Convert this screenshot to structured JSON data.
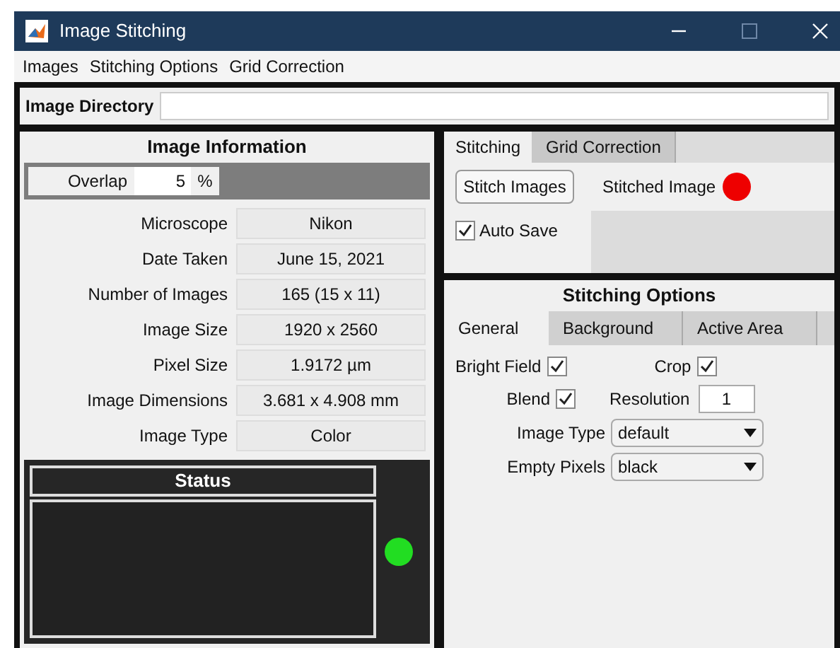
{
  "window": {
    "title": "Image Stitching"
  },
  "menu": [
    "Images",
    "Stitching Options",
    "Grid Correction"
  ],
  "directory": {
    "label": "Image Directory"
  },
  "info": {
    "title": "Image Information",
    "overlap_label": "Overlap",
    "overlap_value": "5",
    "overlap_unit": "%",
    "rows": [
      {
        "label": "Microscope",
        "value": "Nikon"
      },
      {
        "label": "Date Taken",
        "value": "June 15, 2021"
      },
      {
        "label": "Number of Images",
        "value": "165 (15 x 11)"
      },
      {
        "label": "Image Size",
        "value": "1920 x 2560"
      },
      {
        "label": "Pixel Size",
        "value": "1.9172 µm"
      },
      {
        "label": "Image Dimensions",
        "value": "3.681 x 4.908 mm"
      },
      {
        "label": "Image Type",
        "value": "Color"
      }
    ],
    "status": {
      "title": "Status",
      "color": "#22dd22"
    }
  },
  "tabs": [
    {
      "label": "Stitching",
      "selected": true
    },
    {
      "label": "Grid Correction",
      "selected": false
    }
  ],
  "stitch": {
    "button": "Stitch Images",
    "auto_save": {
      "label": "Auto Save",
      "checked": true
    },
    "stitched": {
      "label": "Stitched Image",
      "color": "#ee0000"
    }
  },
  "options": {
    "title": "Stitching Options",
    "tabs": [
      {
        "label": "General",
        "selected": true
      },
      {
        "label": "Background",
        "selected": false
      },
      {
        "label": "Active Area",
        "selected": false
      }
    ],
    "bright_field": {
      "label": "Bright Field",
      "checked": true
    },
    "crop": {
      "label": "Crop",
      "checked": true
    },
    "blend": {
      "label": "Blend",
      "checked": true
    },
    "resolution": {
      "label": "Resolution",
      "value": "1"
    },
    "image_type": {
      "label": "Image Type",
      "value": "default"
    },
    "empty_pixels": {
      "label": "Empty Pixels",
      "value": "black"
    }
  }
}
